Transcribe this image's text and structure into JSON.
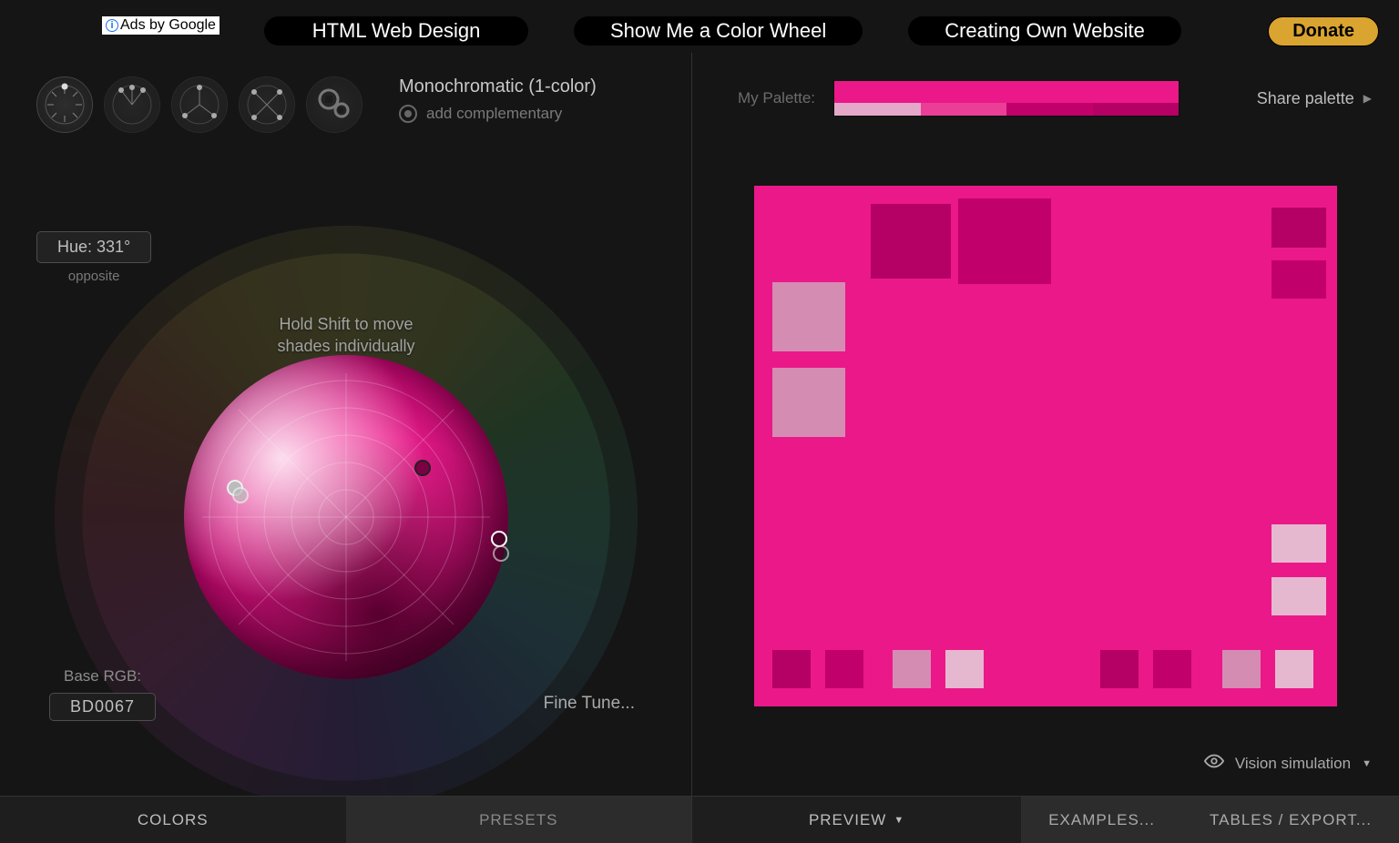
{
  "topbar": {
    "ads_label": "Ads by Google",
    "links": [
      "HTML Web Design",
      "Show Me a Color Wheel",
      "Creating Own Website"
    ],
    "donate": "Donate"
  },
  "scheme": {
    "title": "Monochromatic (1-color)",
    "complementary_label": "add complementary"
  },
  "hue": {
    "label": "Hue: 331°",
    "sub": "opposite"
  },
  "wheel": {
    "hint_line1": "Hold Shift to move",
    "hint_line2": "shades individually"
  },
  "base_rgb": {
    "label": "Base RGB:",
    "value": "BD0067"
  },
  "fine_tune": "Fine Tune...",
  "left_tabs": {
    "colors": "COLORS",
    "presets": "PRESETS"
  },
  "palette": {
    "label": "My Palette:",
    "share": "Share palette",
    "colors": {
      "primary": "#EB1889",
      "dark1": "#B50065",
      "dark2": "#C2006C",
      "light1": "#D58CB3",
      "light2": "#E6B8D0"
    }
  },
  "vision": {
    "label": "Vision simulation"
  },
  "right_tabs": {
    "preview": "PREVIEW",
    "examples": "EXAMPLES...",
    "tables": "TABLES / EXPORT..."
  }
}
